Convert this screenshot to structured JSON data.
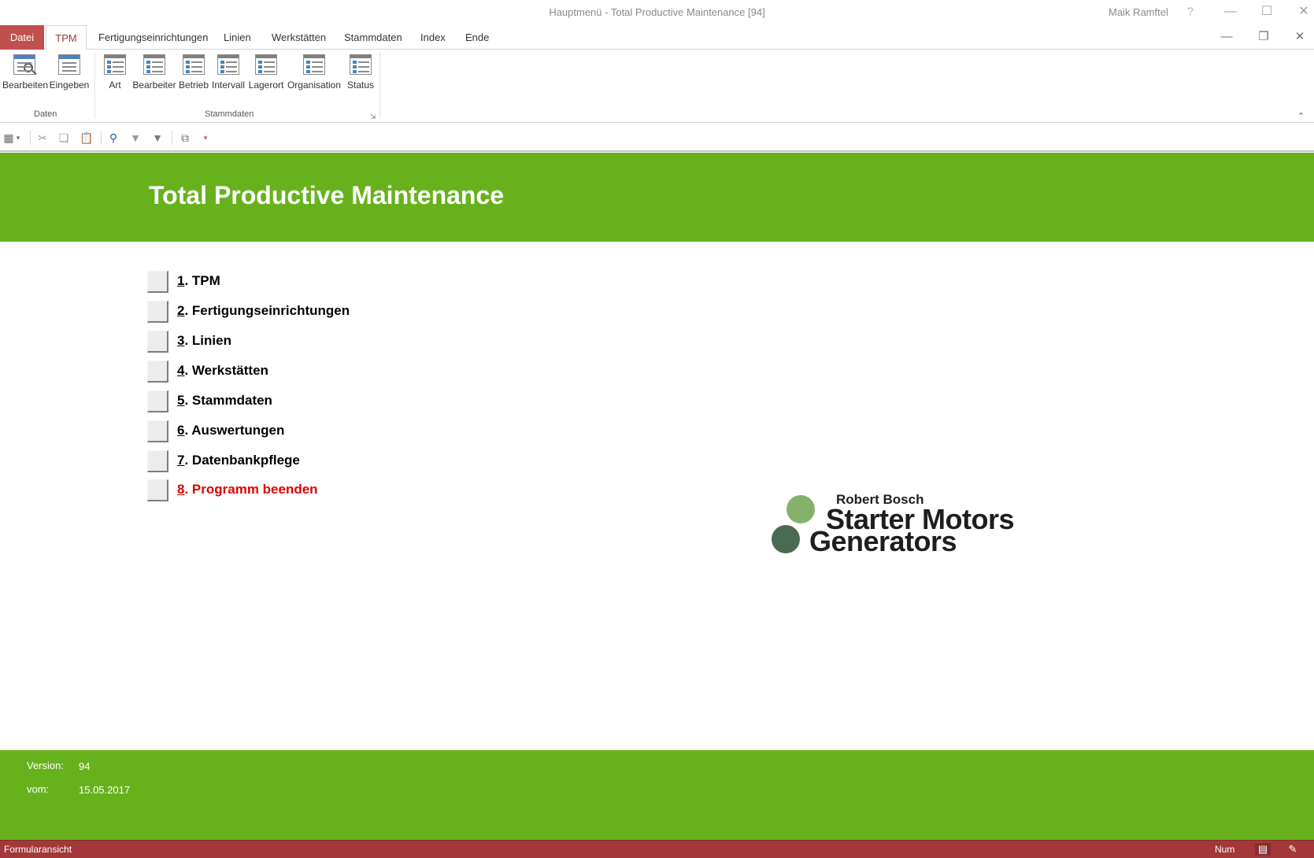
{
  "window": {
    "title": "Hauptmenü  -  Total Productive Maintenance [94]",
    "user": "Maik Ramftel",
    "help": "?"
  },
  "menu": {
    "tabs": [
      "Datei",
      "TPM",
      "Fertigungseinrichtungen",
      "Linien",
      "Werkstätten",
      "Stammdaten",
      "Index",
      "Ende"
    ],
    "active": "TPM"
  },
  "ribbon": {
    "groups": [
      {
        "label": "Daten",
        "buttons": [
          "Bearbeiten",
          "Eingeben"
        ]
      },
      {
        "label": "Stammdaten",
        "buttons": [
          "Art",
          "Bearbeiter",
          "Betrieb",
          "Intervall",
          "Lagerort",
          "Organisation",
          "Status"
        ]
      }
    ]
  },
  "form": {
    "title": "Total Productive Maintenance",
    "items": [
      {
        "num": "1",
        "text": ". TPM",
        "color": "#000000"
      },
      {
        "num": "2",
        "text": ". Fertigungseinrichtungen",
        "color": "#000000"
      },
      {
        "num": "3",
        "text": ". Linien",
        "color": "#000000"
      },
      {
        "num": "4",
        "text": ". Werkstätten",
        "color": "#000000"
      },
      {
        "num": "5",
        "text": ". Stammdaten",
        "color": "#000000"
      },
      {
        "num": "6",
        "text": ". Auswertungen",
        "color": "#000000"
      },
      {
        "num": "7",
        "text": ". Datenbankpflege",
        "color": "#000000"
      },
      {
        "num": "8",
        "text": ". Programm beenden",
        "color": "#e00000"
      }
    ],
    "logo": {
      "line1": "Robert Bosch",
      "line2": "Starter Motors",
      "line3": "Generators"
    },
    "footer": {
      "version_label": "Version:",
      "version_value": "94",
      "date_label": "vom:",
      "date_value": "15.05.2017"
    }
  },
  "status": {
    "left": "Formularansicht",
    "num": "Num"
  },
  "colors": {
    "header_green": "#67b21c",
    "accent_red": "#a4373a",
    "file_tab": "#c0504d",
    "exit_item": "#e00000"
  }
}
